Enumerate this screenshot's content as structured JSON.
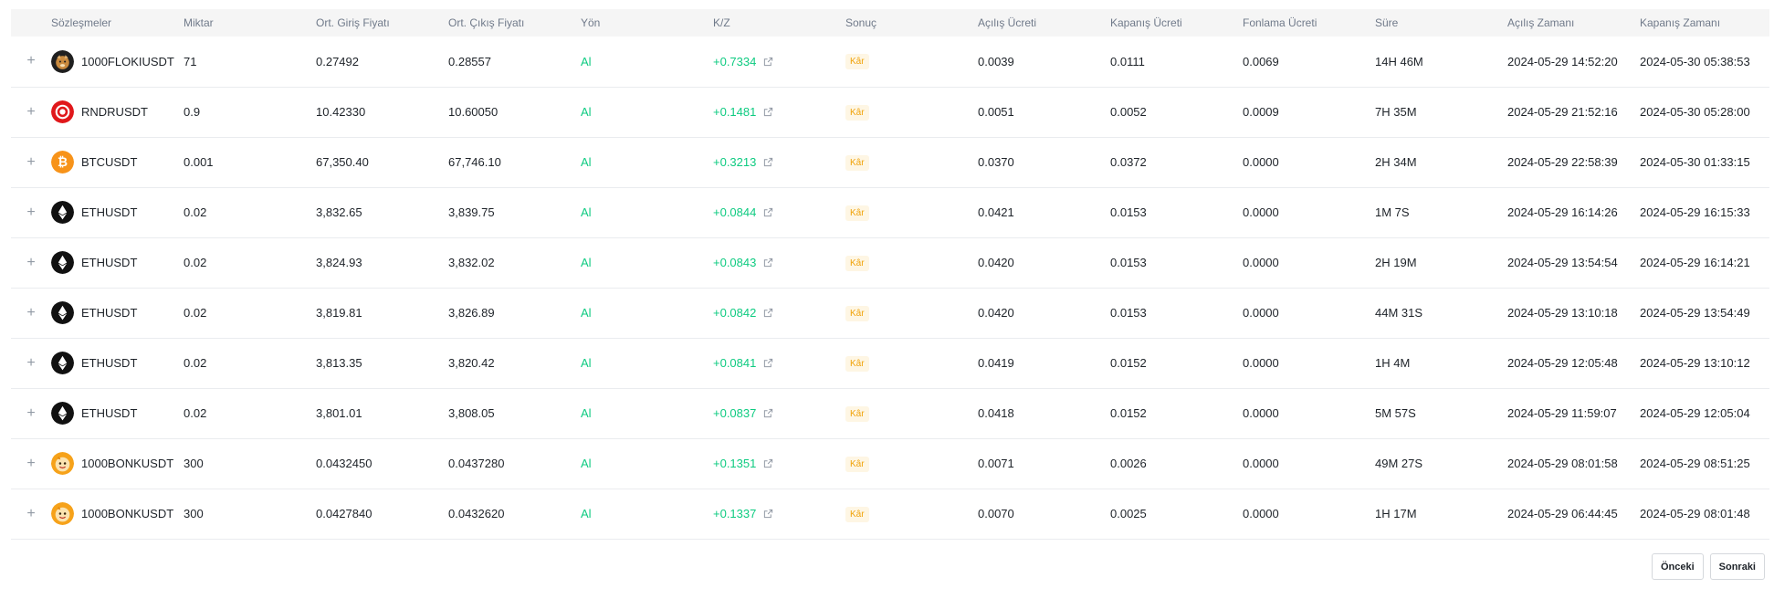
{
  "columns": [
    "Sözleşmeler",
    "Miktar",
    "Ort. Giriş Fiyatı",
    "Ort. Çıkış Fiyatı",
    "Yön",
    "K/Z",
    "Sonuç",
    "Açılış Ücreti",
    "Kapanış Ücreti",
    "Fonlama Ücreti",
    "Süre",
    "Açılış Zamanı",
    "Kapanış Zamanı"
  ],
  "expand_icon": "plus-icon",
  "pnl_icon": "external-link-icon",
  "colors": {
    "positive": "#0ecb81",
    "badge_bg": "#fef6e4",
    "badge_text": "#f0a30a"
  },
  "rows": [
    {
      "coin_icon": "floki-icon",
      "coin_color": "#1f1f1f",
      "symbol": "1000FLOKIUSDT",
      "qty": "71",
      "entry": "0.27492",
      "exit": "0.28557",
      "side": "Al",
      "pnl": "+0.7334",
      "result": "Kâr",
      "open_fee": "0.0039",
      "close_fee": "0.0111",
      "funding_fee": "0.0069",
      "duration": "14H 46M",
      "open_time": "2024-05-29 14:52:20",
      "close_time": "2024-05-30 05:38:53"
    },
    {
      "coin_icon": "rndr-icon",
      "coin_color": "#e0181b",
      "symbol": "RNDRUSDT",
      "qty": "0.9",
      "entry": "10.42330",
      "exit": "10.60050",
      "side": "Al",
      "pnl": "+0.1481",
      "result": "Kâr",
      "open_fee": "0.0051",
      "close_fee": "0.0052",
      "funding_fee": "0.0009",
      "duration": "7H 35M",
      "open_time": "2024-05-29 21:52:16",
      "close_time": "2024-05-30 05:28:00"
    },
    {
      "coin_icon": "bitcoin-icon",
      "coin_color": "#f7931a",
      "symbol": "BTCUSDT",
      "qty": "0.001",
      "entry": "67,350.40",
      "exit": "67,746.10",
      "side": "Al",
      "pnl": "+0.3213",
      "result": "Kâr",
      "open_fee": "0.0370",
      "close_fee": "0.0372",
      "funding_fee": "0.0000",
      "duration": "2H 34M",
      "open_time": "2024-05-29 22:58:39",
      "close_time": "2024-05-30 01:33:15"
    },
    {
      "coin_icon": "ethereum-icon",
      "coin_color": "#111111",
      "symbol": "ETHUSDT",
      "qty": "0.02",
      "entry": "3,832.65",
      "exit": "3,839.75",
      "side": "Al",
      "pnl": "+0.0844",
      "result": "Kâr",
      "open_fee": "0.0421",
      "close_fee": "0.0153",
      "funding_fee": "0.0000",
      "duration": "1M 7S",
      "open_time": "2024-05-29 16:14:26",
      "close_time": "2024-05-29 16:15:33"
    },
    {
      "coin_icon": "ethereum-icon",
      "coin_color": "#111111",
      "symbol": "ETHUSDT",
      "qty": "0.02",
      "entry": "3,824.93",
      "exit": "3,832.02",
      "side": "Al",
      "pnl": "+0.0843",
      "result": "Kâr",
      "open_fee": "0.0420",
      "close_fee": "0.0153",
      "funding_fee": "0.0000",
      "duration": "2H 19M",
      "open_time": "2024-05-29 13:54:54",
      "close_time": "2024-05-29 16:14:21"
    },
    {
      "coin_icon": "ethereum-icon",
      "coin_color": "#111111",
      "symbol": "ETHUSDT",
      "qty": "0.02",
      "entry": "3,819.81",
      "exit": "3,826.89",
      "side": "Al",
      "pnl": "+0.0842",
      "result": "Kâr",
      "open_fee": "0.0420",
      "close_fee": "0.0153",
      "funding_fee": "0.0000",
      "duration": "44M 31S",
      "open_time": "2024-05-29 13:10:18",
      "close_time": "2024-05-29 13:54:49"
    },
    {
      "coin_icon": "ethereum-icon",
      "coin_color": "#111111",
      "symbol": "ETHUSDT",
      "qty": "0.02",
      "entry": "3,813.35",
      "exit": "3,820.42",
      "side": "Al",
      "pnl": "+0.0841",
      "result": "Kâr",
      "open_fee": "0.0419",
      "close_fee": "0.0152",
      "funding_fee": "0.0000",
      "duration": "1H 4M",
      "open_time": "2024-05-29 12:05:48",
      "close_time": "2024-05-29 13:10:12"
    },
    {
      "coin_icon": "ethereum-icon",
      "coin_color": "#111111",
      "symbol": "ETHUSDT",
      "qty": "0.02",
      "entry": "3,801.01",
      "exit": "3,808.05",
      "side": "Al",
      "pnl": "+0.0837",
      "result": "Kâr",
      "open_fee": "0.0418",
      "close_fee": "0.0152",
      "funding_fee": "0.0000",
      "duration": "5M 57S",
      "open_time": "2024-05-29 11:59:07",
      "close_time": "2024-05-29 12:05:04"
    },
    {
      "coin_icon": "bonk-icon",
      "coin_color": "#f6a21a",
      "symbol": "1000BONKUSDT",
      "qty": "300",
      "entry": "0.0432450",
      "exit": "0.0437280",
      "side": "Al",
      "pnl": "+0.1351",
      "result": "Kâr",
      "open_fee": "0.0071",
      "close_fee": "0.0026",
      "funding_fee": "0.0000",
      "duration": "49M 27S",
      "open_time": "2024-05-29 08:01:58",
      "close_time": "2024-05-29 08:51:25"
    },
    {
      "coin_icon": "bonk-icon",
      "coin_color": "#f6a21a",
      "symbol": "1000BONKUSDT",
      "qty": "300",
      "entry": "0.0427840",
      "exit": "0.0432620",
      "side": "Al",
      "pnl": "+0.1337",
      "result": "Kâr",
      "open_fee": "0.0070",
      "close_fee": "0.0025",
      "funding_fee": "0.0000",
      "duration": "1H 17M",
      "open_time": "2024-05-29 06:44:45",
      "close_time": "2024-05-29 08:01:48"
    }
  ],
  "pagination": {
    "prev_label": "Önceki",
    "next_label": "Sonraki"
  }
}
